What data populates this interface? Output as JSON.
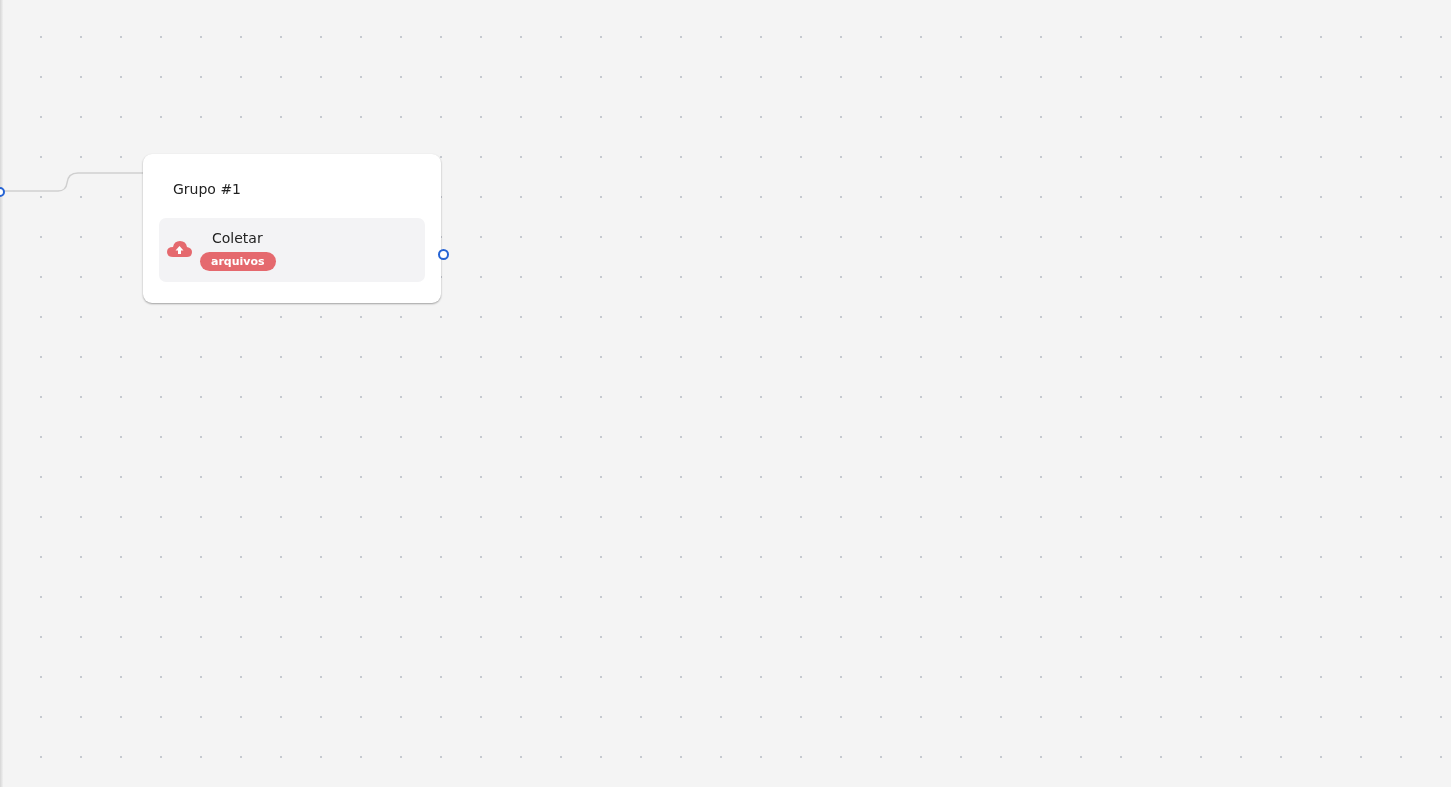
{
  "node": {
    "title": "Grupo #1",
    "steps": [
      {
        "kind": "upload",
        "title": "Coletar",
        "tag": "arquivos",
        "color": "#e5696e"
      }
    ]
  }
}
